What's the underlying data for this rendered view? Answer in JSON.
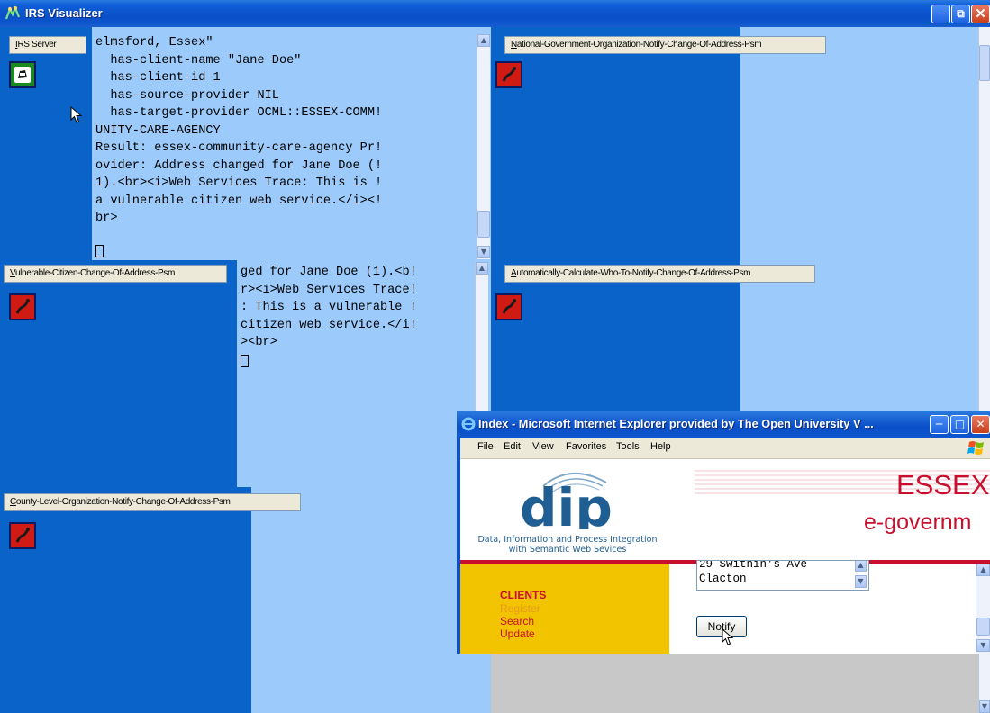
{
  "window": {
    "title": "IRS Visualizer"
  },
  "panels": {
    "irs_server": {
      "tab_label": "IRS Server",
      "tab_underline": "I",
      "tab_rest": "RS Server",
      "log_lines": [
        "elmsford, Essex\"",
        "  has-client-name \"Jane Doe\"",
        "  has-client-id 1",
        "  has-source-provider NIL",
        "  has-target-provider OCML::ESSEX-COMM!",
        "UNITY-CARE-AGENCY",
        "Result: essex-community-care-agency Pr!",
        "ovider: Address changed for Jane Doe (!",
        "1).<br><i>Web Services Trace: This is !",
        "a vulnerable citizen web service.</i><!",
        "br>"
      ]
    },
    "national": {
      "tab_underline": "N",
      "tab_rest": "ational-Government-Organization-Notify-Change-Of-Address-Psm"
    },
    "vulnerable": {
      "tab_underline": "V",
      "tab_rest": "ulnerable-Citizen-Change-Of-Address-Psm",
      "log_lines": [
        "ged for Jane Doe (1).<b!",
        "r><i>Web Services Trace!",
        ": This is a vulnerable !",
        "citizen web service.</i!",
        "><br>"
      ]
    },
    "automatic": {
      "tab_underline": "A",
      "tab_rest": "utomatically-Calculate-Who-To-Notify-Change-Of-Address-Psm"
    },
    "county": {
      "tab_underline": "C",
      "tab_rest": "ounty-Level-Organization-Notify-Change-Of-Address-Psm"
    }
  },
  "browser": {
    "title": "Index - Microsoft Internet Explorer provided by The Open University V ...",
    "menu": [
      "File",
      "Edit",
      "View",
      "Favorites",
      "Tools",
      "Help"
    ],
    "logo_text": "dip",
    "logo_caption_1": "Data, Information and Process Integration",
    "logo_caption_2": "with Semantic Web Sevices",
    "banner_title": "ESSEX",
    "banner_subtitle": "e-governm",
    "nav": {
      "heading": "CLIENTS",
      "links": [
        "Register",
        "Search",
        "Update"
      ]
    },
    "address_lines": [
      "29 Swithin's Ave",
      "Clacton"
    ],
    "notify_button": "Notify"
  },
  "colors": {
    "pane_dark": "#0a63c8",
    "pane_light": "#9ccbfb",
    "agent_icon": "#d01a14",
    "server_icon": "#1a8a20",
    "essex_red": "#c8102e",
    "nav_yellow": "#f2c400"
  }
}
